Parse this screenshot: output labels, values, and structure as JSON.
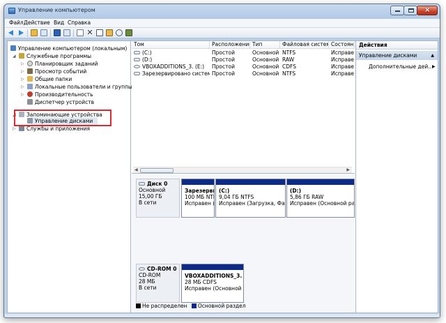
{
  "window": {
    "title": "Управление компьютером"
  },
  "menu": [
    "Файл",
    "Действие",
    "Вид",
    "Справка"
  ],
  "toolbar": {
    "icons": [
      "back-arrow-icon",
      "forward-arrow-icon",
      "up-folder-icon",
      "console-tree-icon",
      "help-icon",
      "properties-icon",
      "refresh-icon",
      "delete-icon",
      "properties-sheet-icon",
      "open-folder-icon",
      "search-icon",
      "disk-icon"
    ]
  },
  "tree": {
    "root": "Управление компьютером (локальным)",
    "items": [
      "Служебные программы",
      "Планировщик заданий",
      "Просмотр событий",
      "Общие папки",
      "Локальные пользователи и группы",
      "Производительность",
      "Диспетчер устройств",
      "Запоминающие устройства",
      "Управление дисками",
      "Службы и приложения"
    ]
  },
  "volumes": {
    "headers": [
      "Том",
      "Расположение",
      "Тип",
      "Файловая система",
      "Состоян"
    ],
    "rows": [
      [
        "(C:)",
        "Простой",
        "Основной",
        "NTFS",
        "Исправе"
      ],
      [
        "(D:)",
        "Простой",
        "Основной",
        "RAW",
        "Исправе"
      ],
      [
        "VBOXADDITIONS_3. (E:)",
        "Простой",
        "Основной",
        "CDFS",
        "Исправе"
      ],
      [
        "Зарезервировано системой",
        "Простой",
        "Основной",
        "NTFS",
        "Исправе"
      ]
    ]
  },
  "disks": [
    {
      "name": "Диск 0",
      "type": "Основной",
      "size": "15,00 ГБ",
      "status": "В сети",
      "partitions": [
        {
          "name": "Зарезервиро",
          "info": "100 МБ NTFS",
          "state": "Исправен (С"
        },
        {
          "name": "(C:)",
          "info": "9,04 ГБ NTFS",
          "state": "Исправен (Загрузка, Файл"
        },
        {
          "name": "(D:)",
          "info": "5,86 ГБ RAW",
          "state": "Исправен (Основной раз"
        }
      ]
    },
    {
      "name": "CD-ROM 0",
      "type": "CD-ROM",
      "size": "28 МБ",
      "status": "В сети",
      "partitions": [
        {
          "name": "VBOXADDITIONS_3.",
          "info": "28 МБ CDFS",
          "state": "Исправен (Основной"
        }
      ]
    }
  ],
  "legend": [
    {
      "label": "Не распределен",
      "color": "#000000"
    },
    {
      "label": "Основной раздел",
      "color": "#0c2a8a"
    }
  ],
  "actions": {
    "title": "Действия",
    "section": "Управление дисками",
    "item": "Дополнительные дей..."
  }
}
